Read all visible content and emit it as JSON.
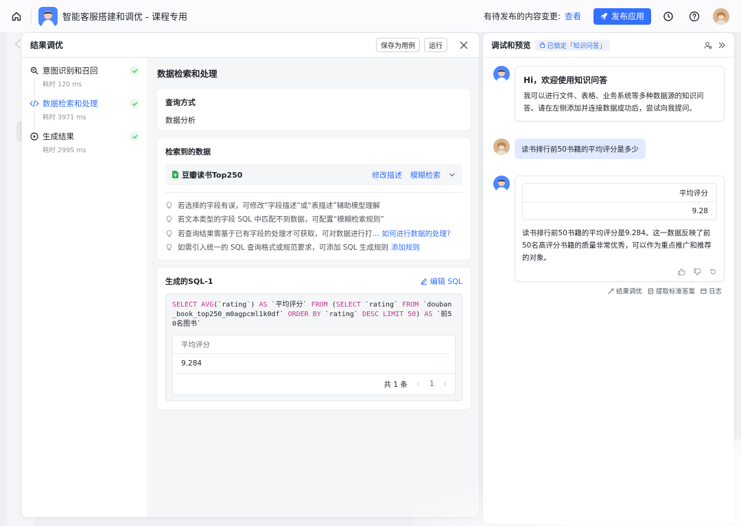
{
  "topbar": {
    "app_title": "智能客服搭建和调优 - 课程专用",
    "pending_text": "有待发布的内容变更:",
    "pending_link": "查看",
    "publish_label": "发布应用"
  },
  "main": {
    "title": "结果调优",
    "save_case_label": "保存为用例",
    "run_label": "运行",
    "steps": [
      {
        "label": "意图识别和召回",
        "time": "耗时 120 ms",
        "icon": "search-doc-icon"
      },
      {
        "label": "数据检索和处理",
        "time": "耗时 3971 ms",
        "icon": "code-icon"
      },
      {
        "label": "生成结果",
        "time": "耗时 2995 ms",
        "icon": "play-circle-icon"
      }
    ],
    "content_title": "数据检索和处理",
    "query": {
      "label": "查询方式",
      "value": "数据分析"
    },
    "retrieved": {
      "label": "检索到的数据",
      "dataset_name": "豆瓣读书Top250",
      "edit_desc": "修改描述",
      "fuzzy_search": "模糊检索",
      "hints": [
        {
          "text": "若选择的字段有误，可修改“字段描述”或“表描述”辅助模型理解",
          "link": ""
        },
        {
          "text": "若文本类型的字段 SQL 中匹配不到数据，可配置“模糊检索规则”",
          "link": ""
        },
        {
          "text": "若查询结果需基于已有字段的处理才可获取，可对数据进行打...",
          "link": "如何进行数据的处理?"
        },
        {
          "text": "如需引入统一的 SQL 查询格式或规范要求，可添加 SQL 生成规则",
          "link": "添加规则"
        }
      ]
    },
    "sql": {
      "label": "生成的SQL-1",
      "edit_label": "编辑 SQL",
      "tokens": [
        {
          "t": "SELECT",
          "k": true
        },
        {
          "t": " ",
          "k": false
        },
        {
          "t": "AVG",
          "k": true
        },
        {
          "t": "(`rating`) ",
          "k": false
        },
        {
          "t": "AS",
          "k": true
        },
        {
          "t": " `平均评分` ",
          "k": false
        },
        {
          "t": "FROM",
          "k": true
        },
        {
          "t": " (",
          "k": false
        },
        {
          "t": "SELECT",
          "k": true
        },
        {
          "t": " `rating` ",
          "k": false
        },
        {
          "t": "FROM",
          "k": true
        },
        {
          "t": " `douban_book_top250_m0agpcml1k0df` ",
          "k": false
        },
        {
          "t": "ORDER BY",
          "k": true
        },
        {
          "t": " `rating` ",
          "k": false
        },
        {
          "t": "DESC LIMIT",
          "k": true
        },
        {
          "t": " ",
          "k": false
        },
        {
          "t": "50",
          "k": true
        },
        {
          "t": ") ",
          "k": false
        },
        {
          "t": "AS",
          "k": true
        },
        {
          "t": " `前50名图书`",
          "k": false
        }
      ],
      "result_header": "平均评分",
      "result_value": "9.284",
      "total_text": "共 1 条",
      "current_page": "1"
    }
  },
  "preview": {
    "title": "调试和预览",
    "lock_label": "已锁定「知识问答」",
    "welcome_title": "Hi，欢迎使用知识问答",
    "welcome_text": "我可以进行文件、表格、业务系统等多种数据源的知识问答。请在左侧添加并连接数据成功后，尝试向我提问。",
    "question": "读书排行前50书籍的平均评分是多少",
    "answer_header": "平均评分",
    "answer_value": "9.28",
    "answer_text": "读书排行前50书籍的平均评分是9.284。这一数据反映了前50名高评分书籍的质量非常优秀，可以作为重点推广和推荐的对象。",
    "footer": {
      "tune": "结果调优",
      "extract": "提取标准答案",
      "log": "日志"
    }
  },
  "colors": {
    "accent": "#3370ff",
    "success": "#34c759",
    "sql_keyword": "#c2388f"
  }
}
